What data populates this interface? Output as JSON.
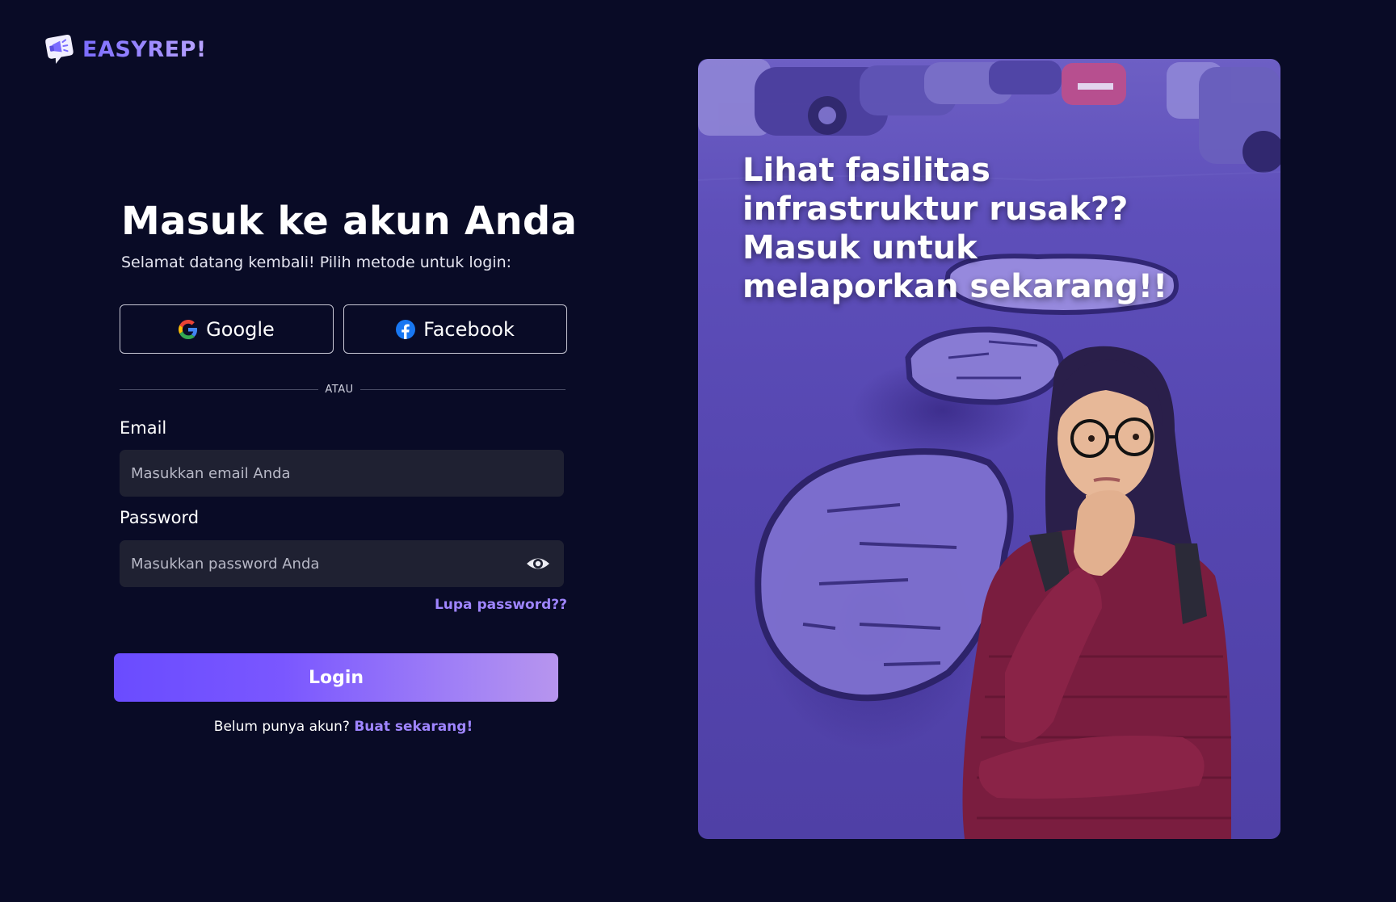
{
  "brand": {
    "name": "EASYREP!"
  },
  "login": {
    "title": "Masuk ke akun Anda",
    "subtitle": "Selamat datang kembali! Pilih metode untuk login:",
    "google_label": "Google",
    "facebook_label": "Facebook",
    "divider_text": "ATAU",
    "email_label": "Email",
    "email_placeholder": "Masukkan email Anda",
    "password_label": "Password",
    "password_placeholder": "Masukkan password Anda",
    "forgot_label": "Lupa password??",
    "login_label": "Login",
    "signup_prompt": "Belum punya akun?",
    "signup_link": "Buat sekarang!"
  },
  "hero": {
    "headline": "Lihat fasilitas infrastruktur rusak?? Masuk untuk melaporkan sekarang!!"
  },
  "colors": {
    "background": "#090b26",
    "accent": "#9f85ff",
    "input_bg": "#1f2132",
    "hero_tint": "#5a4bb5"
  },
  "icons": {
    "logo": "megaphone-chat-icon",
    "google": "google-g-icon",
    "facebook": "facebook-f-icon",
    "password_toggle": "eye-icon"
  }
}
